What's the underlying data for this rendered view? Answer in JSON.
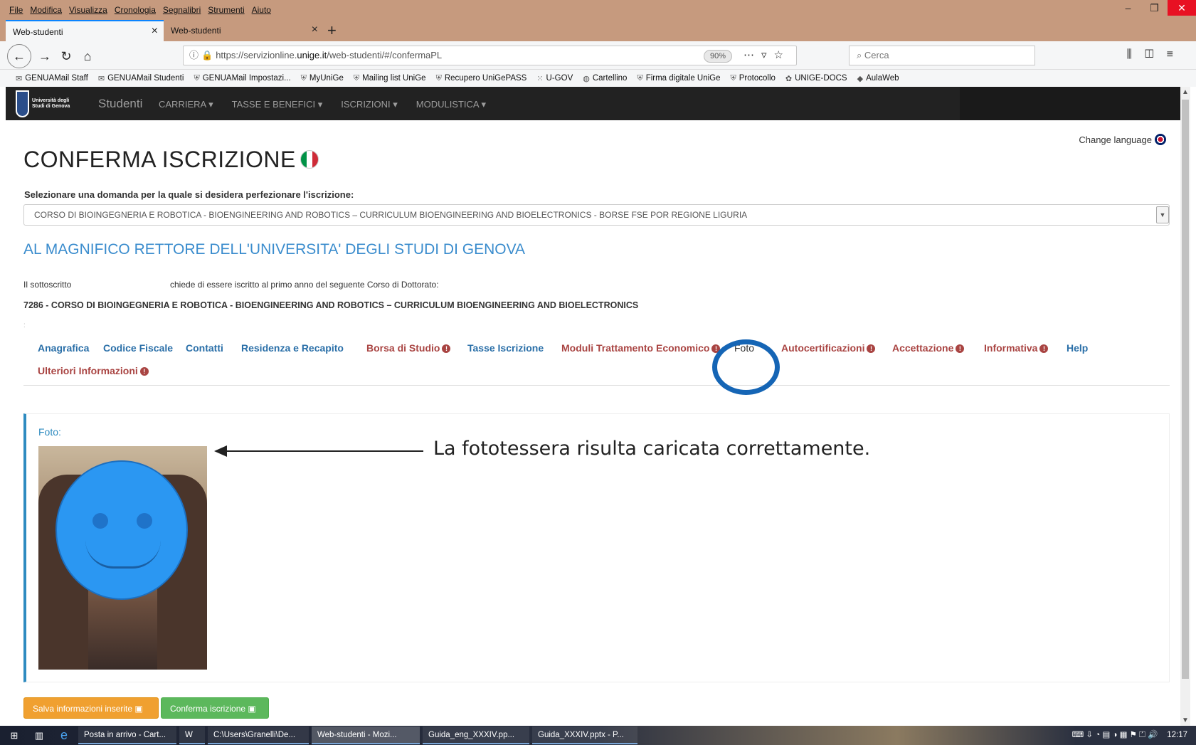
{
  "firefox": {
    "menu": [
      "File",
      "Modifica",
      "Visualizza",
      "Cronologia",
      "Segnalibri",
      "Strumenti",
      "Aiuto"
    ],
    "tabs": [
      {
        "label": "Web-studenti"
      },
      {
        "label": "Web-studenti"
      }
    ],
    "url": {
      "prefix": "https://servizionline.",
      "host": "unige.it",
      "path": "/web-studenti/#/confermaPL"
    },
    "zoom": "90%",
    "search_placeholder": "Cerca",
    "bookmarks": [
      "GENUAMail Staff",
      "GENUAMail Studenti",
      "GENUAMail Impostazi...",
      "MyUniGe",
      "Mailing list UniGe",
      "Recupero UniGePASS",
      "U-GOV",
      "Cartellino",
      "Firma digitale UniGe",
      "Protocollo",
      "UNIGE-DOCS",
      "AulaWeb"
    ]
  },
  "app": {
    "logo_text": "Università degli Studi di Genova",
    "brand": "Studenti",
    "nav": [
      "CARRIERA ▾",
      "TASSE E BENEFICI ▾",
      "ISCRIZIONI ▾",
      "MODULISTICA ▾"
    ],
    "change_language": "Change language"
  },
  "page": {
    "title": "CONFERMA ISCRIZIONE",
    "select_label": "Selezionare una domanda per la quale si desidera perfezionare l'iscrizione:",
    "selected_domanda": "CORSO DI BIOINGEGNERIA E ROBOTICA - BIOENGINEERING AND ROBOTICS – CURRICULUM BIOENGINEERING AND BIOELECTRONICS - BORSE FSE POR REGIONE LIGURIA",
    "rettore": "AL MAGNIFICO RETTORE DELL'UNIVERSITA' DEGLI STUDI DI GENOVA",
    "sottoscritto": "Il sottoscritto",
    "chiede": "chiede di essere iscritto al primo anno del seguente Corso di Dottorato:",
    "corso": "7286 - CORSO DI BIOINGEGNERIA E ROBOTICA - BIOENGINEERING AND ROBOTICS – CURRICULUM BIOENGINEERING AND BIOELECTRONICS",
    "colon": ":",
    "tabs": [
      {
        "label": "Anagrafica",
        "status": "ok"
      },
      {
        "label": "Codice Fiscale",
        "status": "ok"
      },
      {
        "label": "Contatti",
        "status": "ok"
      },
      {
        "label": "Residenza e Recapito",
        "status": "ok"
      },
      {
        "label": "Borsa di Studio",
        "status": "warn"
      },
      {
        "label": "Tasse Iscrizione",
        "status": "ok"
      },
      {
        "label": "Moduli Trattamento Economico",
        "status": "warn"
      },
      {
        "label": "Foto",
        "status": "active"
      },
      {
        "label": "Autocertificazioni",
        "status": "warn"
      },
      {
        "label": "Accettazione",
        "status": "warn"
      },
      {
        "label": "Informativa",
        "status": "warn"
      },
      {
        "label": "Help",
        "status": "ok"
      },
      {
        "label": "Ulteriori Informazioni",
        "status": "warn"
      }
    ],
    "foto_label": "Foto:",
    "annotation": "La fototessera risulta caricata correttamente.",
    "save_button": "Salva informazioni inserite",
    "confirm_button": "Conferma iscrizione"
  },
  "taskbar": {
    "items": [
      "Posta in arrivo - Cart...",
      "C:\\Users\\Granelli\\De...",
      "Web-studenti - Mozi...",
      "Guida_eng_XXXIV.pp...",
      "Guida_XXXIV.pptx - P..."
    ],
    "clock": "12:17"
  },
  "colors": {
    "link": "#2a6fa8",
    "warn": "#a94442",
    "accent": "#1565b5",
    "save": "#f0a030",
    "confirm": "#5cb85c"
  }
}
